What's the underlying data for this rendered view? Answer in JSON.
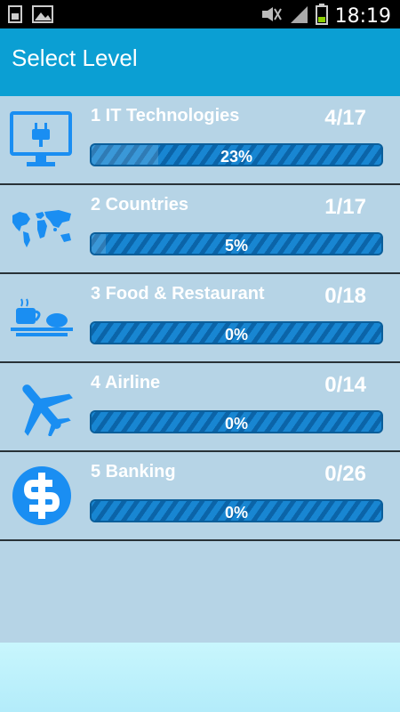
{
  "statusbar": {
    "time": "18:19",
    "icons": [
      "sim-icon",
      "image-icon",
      "mute-icon",
      "signal-icon",
      "battery-icon"
    ]
  },
  "header": {
    "title": "Select Level",
    "background": "#0b9fd3"
  },
  "levels": [
    {
      "title": "1 IT Technologies",
      "count": "4/17",
      "percent_text": "23%",
      "progress": 0.23,
      "icon": "monitor-plug-icon"
    },
    {
      "title": "2 Countries",
      "count": "1/17",
      "percent_text": "5%",
      "progress": 0.05,
      "icon": "world-map-icon"
    },
    {
      "title": "3 Food & Restaurant",
      "count": "0/18",
      "percent_text": "0%",
      "progress": 0.0,
      "icon": "food-tray-icon"
    },
    {
      "title": "4 Airline",
      "count": "0/14",
      "percent_text": "0%",
      "progress": 0.0,
      "icon": "airplane-icon"
    },
    {
      "title": "5 Banking",
      "count": "0/26",
      "percent_text": "0%",
      "progress": 0.0,
      "icon": "dollar-icon"
    }
  ],
  "colors": {
    "accent": "#0b9fd3",
    "icon_blue": "#1a8ef2",
    "row_bg": "#b6d4e6",
    "progress_blue": "#1886d2"
  }
}
